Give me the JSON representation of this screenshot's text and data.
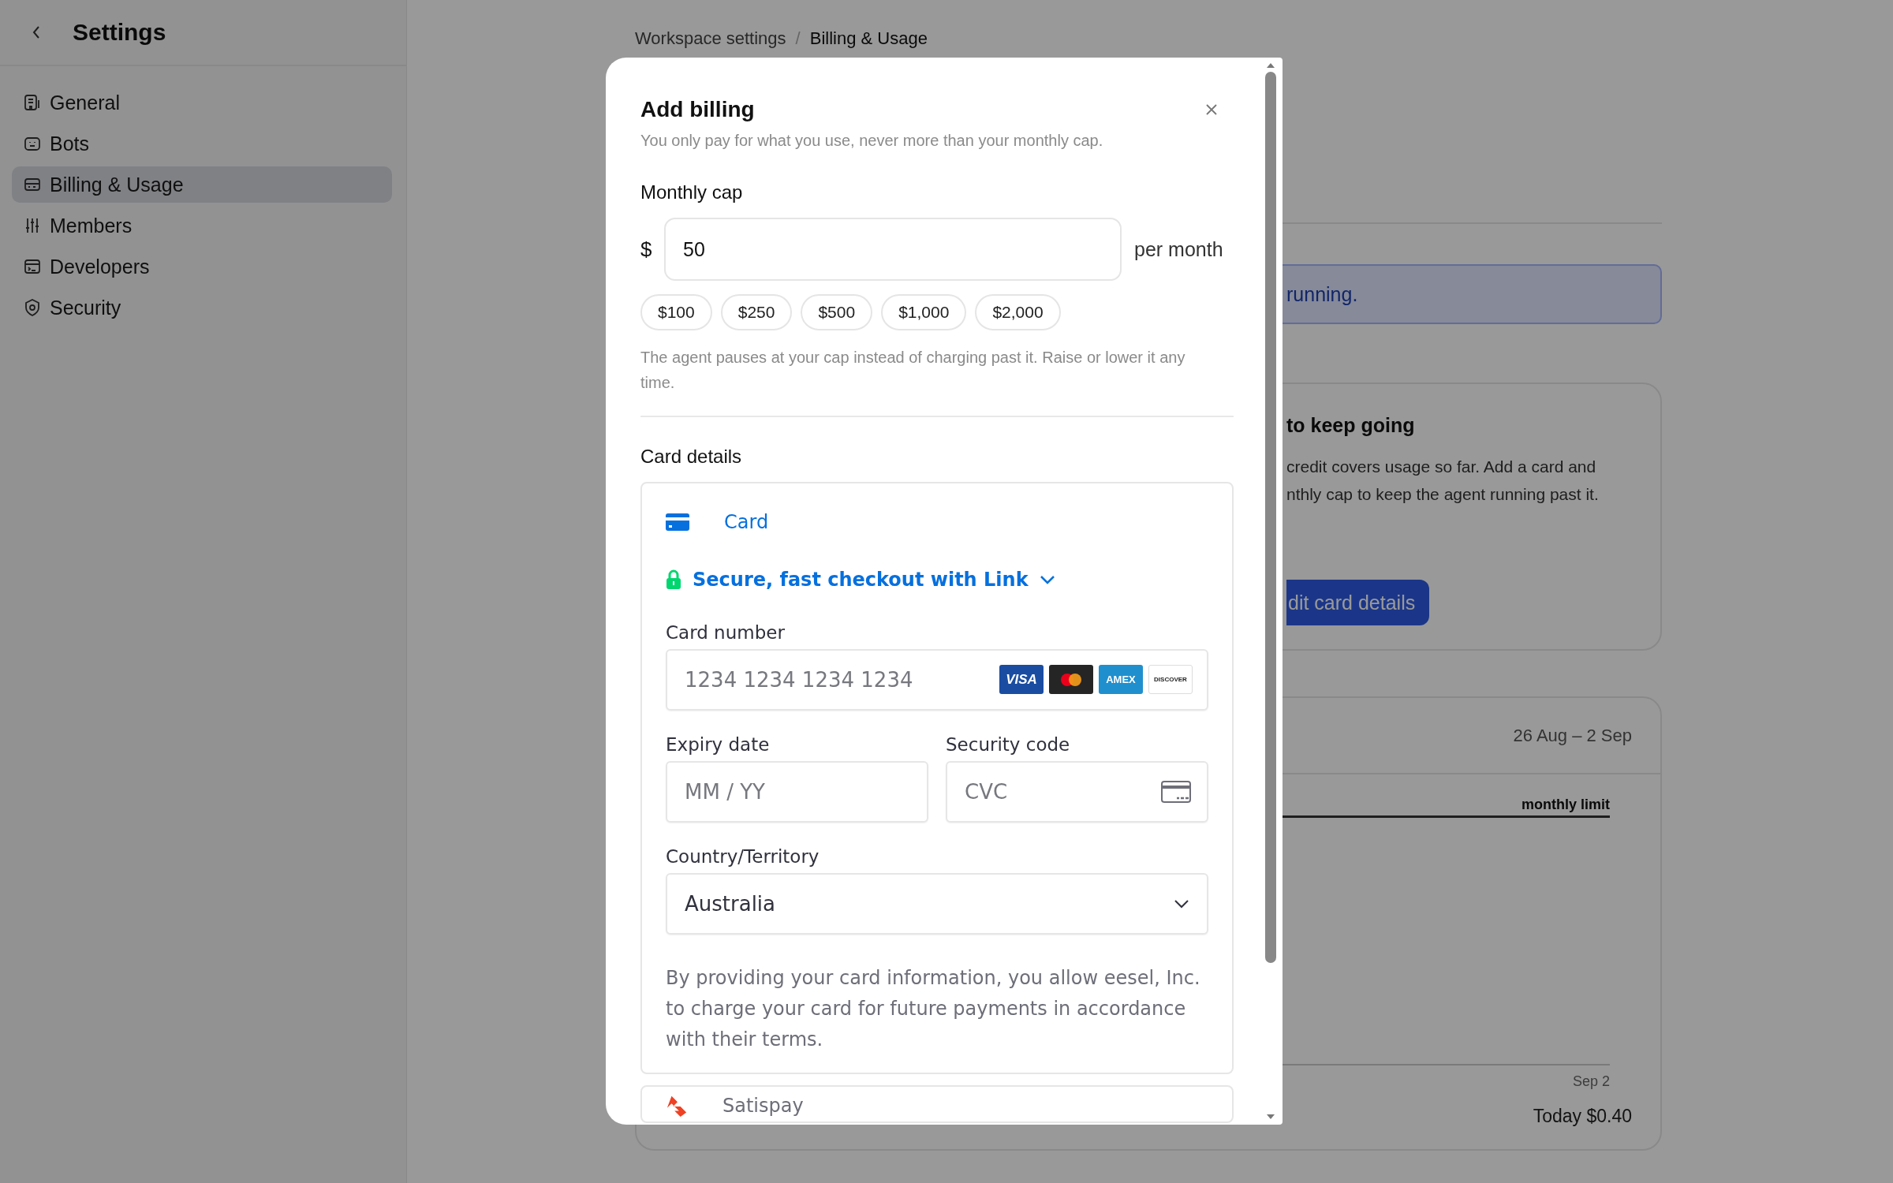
{
  "sidebar": {
    "title": "Settings",
    "items": [
      {
        "label": "General",
        "selected": false
      },
      {
        "label": "Bots",
        "selected": false
      },
      {
        "label": "Billing & Usage",
        "selected": true
      },
      {
        "label": "Members",
        "selected": false
      },
      {
        "label": "Developers",
        "selected": false
      },
      {
        "label": "Security",
        "selected": false
      }
    ]
  },
  "breadcrumb": {
    "separator": "/",
    "items": [
      "Workspace settings",
      "Billing & Usage"
    ]
  },
  "background": {
    "banner": "running.",
    "card": {
      "title": "to keep going",
      "lines": [
        "credit covers usage so far. Add a card and",
        "nthly cap to keep the agent running past it."
      ],
      "button": "dit card details"
    },
    "usage": {
      "date_range": "26 Aug – 2 Sep",
      "limit_label": "monthly limit",
      "axis_label": "Sep 2",
      "total": "Today $0.40"
    }
  },
  "modal": {
    "title": "Add billing",
    "subtitle": "You only pay for what you use, never more than your monthly cap.",
    "cap_label": "Monthly cap",
    "currency": "$",
    "cap_value": "50",
    "cap_unit": "per month",
    "presets": [
      "$100",
      "$250",
      "$500",
      "$1,000",
      "$2,000"
    ],
    "cap_hint": "The agent pauses at your cap instead of charging past it. Raise or lower it any time.",
    "card_section_label": "Card details",
    "payment_methods": [
      {
        "kind": "card",
        "label": "Card",
        "selected": true
      },
      {
        "kind": "satispay",
        "label": "Satispay",
        "selected": false
      }
    ],
    "link_label": "Secure, fast checkout with Link",
    "card_number": {
      "label": "Card number",
      "placeholder": "1234 1234 1234 1234"
    },
    "card_brands": [
      {
        "kind": "visa",
        "label": "VISA"
      },
      {
        "kind": "mastercard"
      },
      {
        "kind": "amex",
        "label": "AMEX"
      },
      {
        "kind": "discover",
        "label": "DISCOVER"
      }
    ],
    "expiry": {
      "label": "Expiry date",
      "placeholder": "MM / YY"
    },
    "security": {
      "label": "Security code",
      "placeholder": "CVC"
    },
    "country": {
      "label": "Country/Territory",
      "value": "Australia"
    },
    "legal": "By providing your card information, you allow eesel, Inc. to charge your card for future payments in accordance with their terms."
  }
}
